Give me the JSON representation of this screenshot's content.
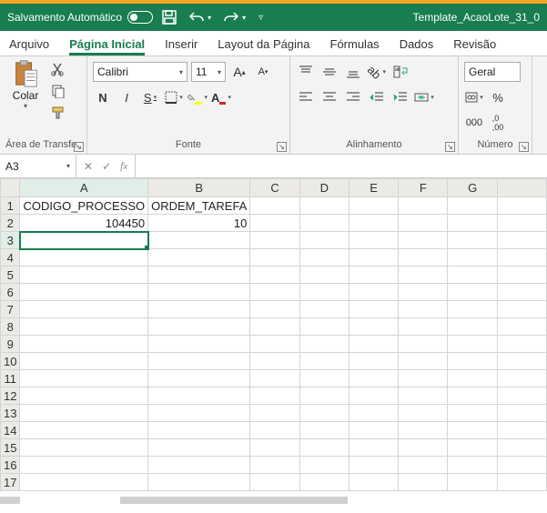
{
  "titlebar": {
    "autosave_label": "Salvamento Automático",
    "document_title": "Template_AcaoLote_31_0"
  },
  "tabs": {
    "arquivo": "Arquivo",
    "home": "Página Inicial",
    "inserir": "Inserir",
    "layout": "Layout da Página",
    "formulas": "Fórmulas",
    "dados": "Dados",
    "revisao": "Revisão"
  },
  "ribbon": {
    "clipboard": {
      "paste_label": "Colar",
      "group_label": "Área de Transfe..."
    },
    "font": {
      "font_name": "Calibri",
      "font_size": "11",
      "group_label": "Fonte",
      "bold": "N",
      "italic": "I",
      "underline": "S",
      "fill_color": "#ffff00",
      "font_color": "#d02a1e"
    },
    "alignment": {
      "group_label": "Alinhamento"
    },
    "number": {
      "format": "Geral",
      "group_label": "Número"
    }
  },
  "namebox": "A3",
  "formula_value": "",
  "columns": [
    "A",
    "B",
    "C",
    "D",
    "E",
    "F",
    "G"
  ],
  "rows": [
    "1",
    "2",
    "3",
    "4",
    "5",
    "6",
    "7",
    "8",
    "9",
    "10",
    "11",
    "12",
    "13",
    "14",
    "15",
    "16",
    "17"
  ],
  "cells": {
    "A1": "CODIGO_PROCESSO",
    "B1": "ORDEM_TAREFA",
    "A2": "104450",
    "B2": "10"
  },
  "selected_cell": "A3"
}
